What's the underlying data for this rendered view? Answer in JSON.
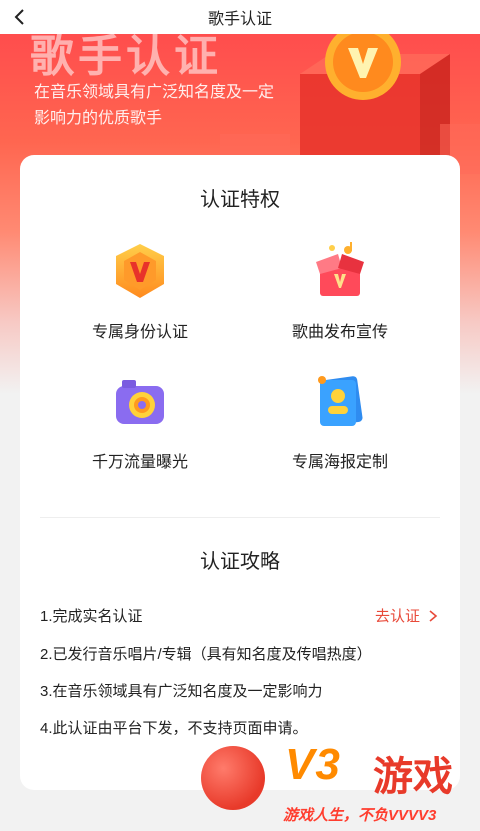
{
  "header": {
    "title": "歌手认证",
    "back_icon": "chevron-left-icon"
  },
  "hero": {
    "title": "歌手认证",
    "description": "在音乐领域具有广泛知名度及一定影响力的优质歌手"
  },
  "privileges": {
    "title": "认证特权",
    "items": [
      {
        "label": "专属身份认证",
        "icon": "v-badge-icon"
      },
      {
        "label": "歌曲发布宣传",
        "icon": "gift-box-icon"
      },
      {
        "label": "千万流量曝光",
        "icon": "camera-icon"
      },
      {
        "label": "专属海报定制",
        "icon": "poster-icon"
      }
    ]
  },
  "guide": {
    "title": "认证攻略",
    "steps": [
      "1.完成实名认证",
      "2.已发行音乐唱片/专辑（具有知名度及传唱热度）",
      "3.在音乐领域具有广泛知名度及一定影响力",
      "4.此认证由平台下发，不支持页面申请。"
    ],
    "action_label": "去认证"
  },
  "watermark": {
    "brand": "V3",
    "name": "游戏",
    "slogan": "游戏人生，不负VVVV3"
  },
  "colors": {
    "accent": "#e84a3a",
    "hero_top": "#ff4d4d"
  }
}
